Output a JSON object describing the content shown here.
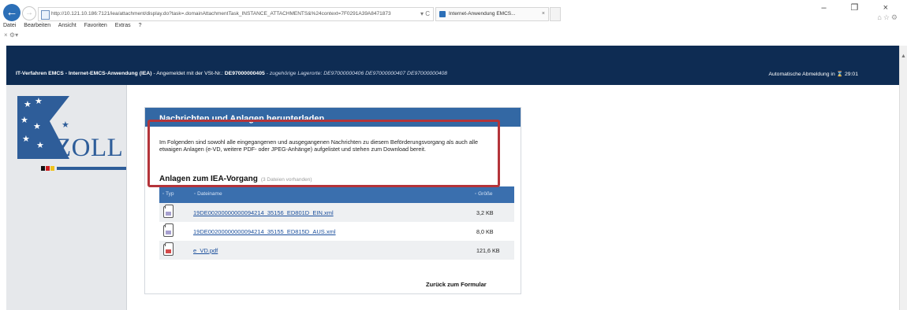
{
  "browser": {
    "url": "http://10.121.10.186:7121/iea/attachment/display.do?task=.domainAttachmentTask_INSTANCE_ATTACHMENTS&%24context=7F0291A39A8471873",
    "tab_label": "Internet-Anwendung EMCS...",
    "tab_close": "×",
    "menu": [
      "Datei",
      "Bearbeiten",
      "Ansicht",
      "Favoriten",
      "Extras",
      "?"
    ],
    "window_controls": "– ❐ ×",
    "address_controls": "▾ C"
  },
  "header": {
    "app_title": "IT-Verfahren EMCS - Internet-EMCS-Anwendung (IEA)",
    "login_prefix": " - Angemeldet mit der VSt-Nr.: ",
    "vst_nr": "DE97000000405",
    "lagerorte_label": " - zugehörige Lagerorte: ",
    "lagerorte": "DE97000000406 DE97000000407 DE97000000408",
    "logout_label": "Automatische Abmeldung in ",
    "logout_time": "29:01"
  },
  "logo": {
    "text": "ZOLL"
  },
  "card": {
    "title": "Nachrichten und Anlagen herunterladen",
    "intro": "Im Folgenden sind sowohl alle eingegangenen und ausgegangenen Nachrichten zu diesem Beförderungsvorgang als auch alle etwaigen Anlagen (e-VD, weitere PDF- oder JPEG-Anhänge) aufgelistet und stehen zum Download bereit.",
    "subtitle": "Anlagen zum IEA-Vorgang",
    "file_count": "(3 Dateien vorhanden)",
    "columns": {
      "type": "Typ",
      "name": "Dateiname",
      "size": "Größe"
    },
    "files": [
      {
        "name": "19DE00200000000094214_35156_ED801D_EIN.xml",
        "size": "3,2 KB",
        "icon": "xml-file-icon"
      },
      {
        "name": "19DE00200000000094214_35155_ED815D_AUS.xml",
        "size": "8,0 KB",
        "icon": "xml-file-icon"
      },
      {
        "name": "e_VD.pdf",
        "size": "121,6 KB",
        "icon": "pdf-file-icon"
      }
    ],
    "back_link": "Zurück zum Formular"
  },
  "colors": {
    "header_bg": "#0e2c53",
    "card_header": "#3368a4",
    "highlight": "#b4343a",
    "link": "#1b4f9c"
  }
}
